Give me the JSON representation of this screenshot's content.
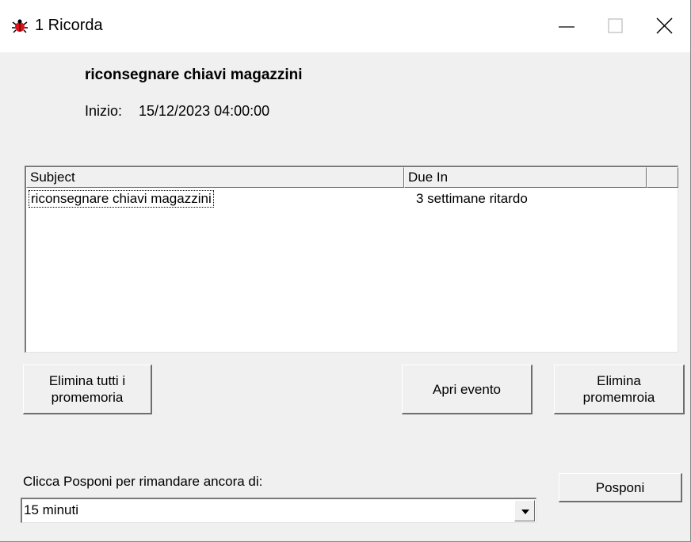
{
  "window": {
    "title": "1 Ricorda",
    "icon": "alarm-bug-icon",
    "controls": [
      "minimize-icon",
      "maximize-icon",
      "close-icon"
    ]
  },
  "reminder": {
    "title": "riconsegnare chiavi magazzini",
    "start_label": "Inizio:",
    "start_value": "15/12/2023 04:00:00"
  },
  "list": {
    "columns": [
      "Subject",
      "Due In",
      ""
    ],
    "rows": [
      {
        "subject": "riconsegnare chiavi magazzini",
        "due_in": "3 settimane ritardo"
      }
    ]
  },
  "buttons": {
    "delete_all": "Elimina tutti i promemoria",
    "open_event": "Apri evento",
    "delete": "Elimina promemroia",
    "snooze": "Posponi"
  },
  "snooze": {
    "label": "Clicca Posponi per rimandare ancora di:",
    "selected": "15 minuti"
  },
  "colors": {
    "background": "#f0f0f0",
    "titlebar": "#ffffff",
    "icon_red": "#e0101a"
  }
}
